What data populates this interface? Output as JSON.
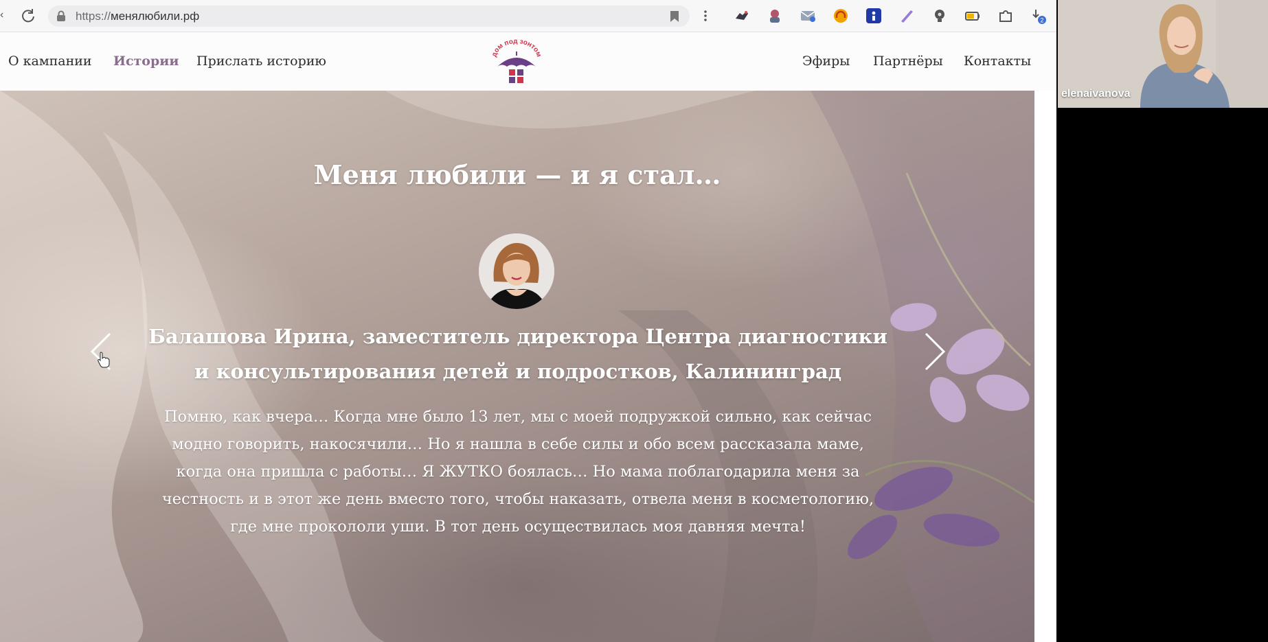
{
  "browser": {
    "url_protocol": "https://",
    "url_host": "менялюбили.рф",
    "download_count": "2"
  },
  "site": {
    "nav_left": [
      "О кампании",
      "Истории",
      "Прислать историю"
    ],
    "nav_right": [
      "Эфиры",
      "Партнёры",
      "Контакты"
    ],
    "active_nav": "Истории",
    "logo_text": "дом под зонтом",
    "colors": {
      "accent": "#8a6c8c",
      "logo_purple": "#6b3f86",
      "logo_red": "#d0344b"
    }
  },
  "hero": {
    "title": "Меня любили — и я стал…",
    "story_name": "Балашова Ирина, заместитель директора Центра диагностики и консультирования детей и подростков, Калининград",
    "story_text": "Помню, как вчера… Когда мне было 13 лет, мы с моей подружкой сильно, как сейчас модно говорить, накосячили… Но я нашла в себе силы и обо всем рассказала маме, когда она пришла с работы… Я ЖУТКО боялась… Но мама поблагодарила меня за честность и в этот же день вместо того, чтобы наказать, отвела меня в косметологию, где мне прокололи уши. В тот день осуществилась моя давняя мечта!"
  },
  "video_call": {
    "participant_name": "elenaivanova"
  }
}
